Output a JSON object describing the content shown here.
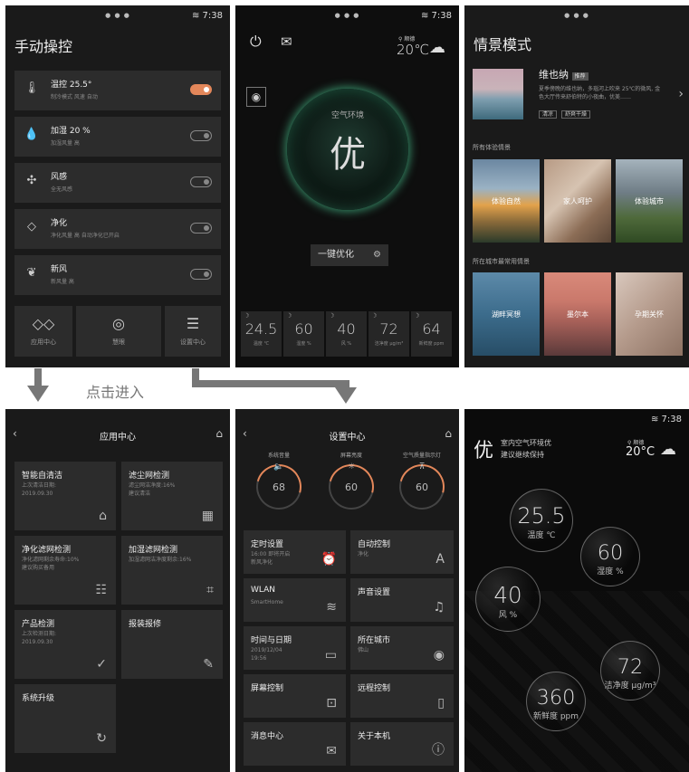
{
  "screen1": {
    "time": "7:38",
    "title": "手动操控",
    "rows": [
      {
        "label": "温控 25.5°",
        "sub": "制冷模式 风速 自动",
        "on": true
      },
      {
        "label": "加湿 20 %",
        "sub": "加湿风量 高",
        "on": false
      },
      {
        "label": "风感",
        "sub": "全无风感",
        "on": false
      },
      {
        "label": "净化",
        "sub": "净化风量 高 自动净化已开启",
        "on": false
      },
      {
        "label": "新风",
        "sub": "新风量 高",
        "on": false
      }
    ],
    "tiles": [
      "应用中心",
      "慧眼",
      "设置中心"
    ]
  },
  "screen2": {
    "time": "7:38",
    "weather_city": "顺德",
    "weather_temp": "20℃",
    "ring_label": "空气环境",
    "ring_value": "优",
    "opt_button": "一键优化",
    "stats": [
      {
        "value": "24.5",
        "label": "温度 ℃"
      },
      {
        "value": "60",
        "label": "湿度 %"
      },
      {
        "value": "40",
        "label": "风 %"
      },
      {
        "value": "72",
        "label": "洁净度 μg/m³"
      },
      {
        "value": "64",
        "label": "新鲜度 ppm"
      }
    ]
  },
  "screen3": {
    "title": "情景模式",
    "featured_title": "维也纳",
    "featured_badge": "推荐",
    "featured_desc": "夏季傍晚的维也纳，多瑙河上吹来 25℃的微风, 金色大厅传来舒伯特的小夜曲，优美……",
    "featured_tags": [
      "清凉",
      "舒爽干燥"
    ],
    "section1": "所有体验情景",
    "section1_items": [
      "体验自然",
      "家人呵护",
      "体验城市"
    ],
    "section2": "所在城市最常用情景",
    "section2_items": [
      "湖畔冥想",
      "墨尔本",
      "孕期关怀"
    ]
  },
  "enter_label": "点击进入",
  "screen4": {
    "title": "应用中心",
    "cards": [
      {
        "title": "智能自清洁",
        "sub": "上次清洁日期:\n2019.09.30",
        "icon": "⌂"
      },
      {
        "title": "滤尘网检测",
        "sub": "滤尘网洁净度:16%\n建议清洁",
        "icon": "▦"
      },
      {
        "title": "净化滤网检测",
        "sub": "净化滤网剩余寿命:10%\n建议购买备用",
        "icon": "☷"
      },
      {
        "title": "加湿滤网检测",
        "sub": "加湿滤网洁净度剩余:16%",
        "icon": "⌗"
      },
      {
        "title": "产品检测",
        "sub": "上次检测日期:\n2019.09.30",
        "icon": "✓"
      },
      {
        "title": "报装报修",
        "sub": "",
        "icon": "✎"
      },
      {
        "title": "系统升级",
        "sub": "",
        "icon": "↻"
      }
    ]
  },
  "screen5": {
    "title": "设置中心",
    "dials": [
      {
        "label": "系统音量",
        "value": "68",
        "icon": "🔈"
      },
      {
        "label": "屏幕亮度",
        "value": "60",
        "icon": "☼"
      },
      {
        "label": "空气质量指示灯",
        "value": "60",
        "icon": "⊼"
      }
    ],
    "cards": [
      {
        "title": "定时设置",
        "sub": "16:00 即将开启\n新风净化",
        "icon": "⏰"
      },
      {
        "title": "自动控制",
        "sub": "净化",
        "icon": "A"
      },
      {
        "title": "WLAN",
        "sub": "SmartHome",
        "icon": "≋"
      },
      {
        "title": "声音设置",
        "sub": "",
        "icon": "♫"
      },
      {
        "title": "时间与日期",
        "sub": "2019/12/04\n19:56",
        "icon": "▭"
      },
      {
        "title": "所在城市",
        "sub": "佛山",
        "icon": "◉"
      },
      {
        "title": "屏幕控制",
        "sub": "",
        "icon": "⊡"
      },
      {
        "title": "远程控制",
        "sub": "",
        "icon": "▯"
      },
      {
        "title": "消息中心",
        "sub": "",
        "icon": "✉"
      },
      {
        "title": "关于本机",
        "sub": "",
        "icon": "ⓘ"
      }
    ]
  },
  "screen6": {
    "time": "7:38",
    "big": "优",
    "line1": "室内空气环境优",
    "line2": "建议继续保持",
    "weather_city": "顺德",
    "weather_temp": "20°C",
    "bubbles": [
      {
        "value": "25.5",
        "label": "温度 ℃"
      },
      {
        "value": "60",
        "label": "湿度 %"
      },
      {
        "value": "40",
        "label": "风 %"
      },
      {
        "value": "72",
        "label": "洁净度 μg/m³"
      },
      {
        "value": "360",
        "label": "新鲜度 ppm"
      }
    ]
  }
}
